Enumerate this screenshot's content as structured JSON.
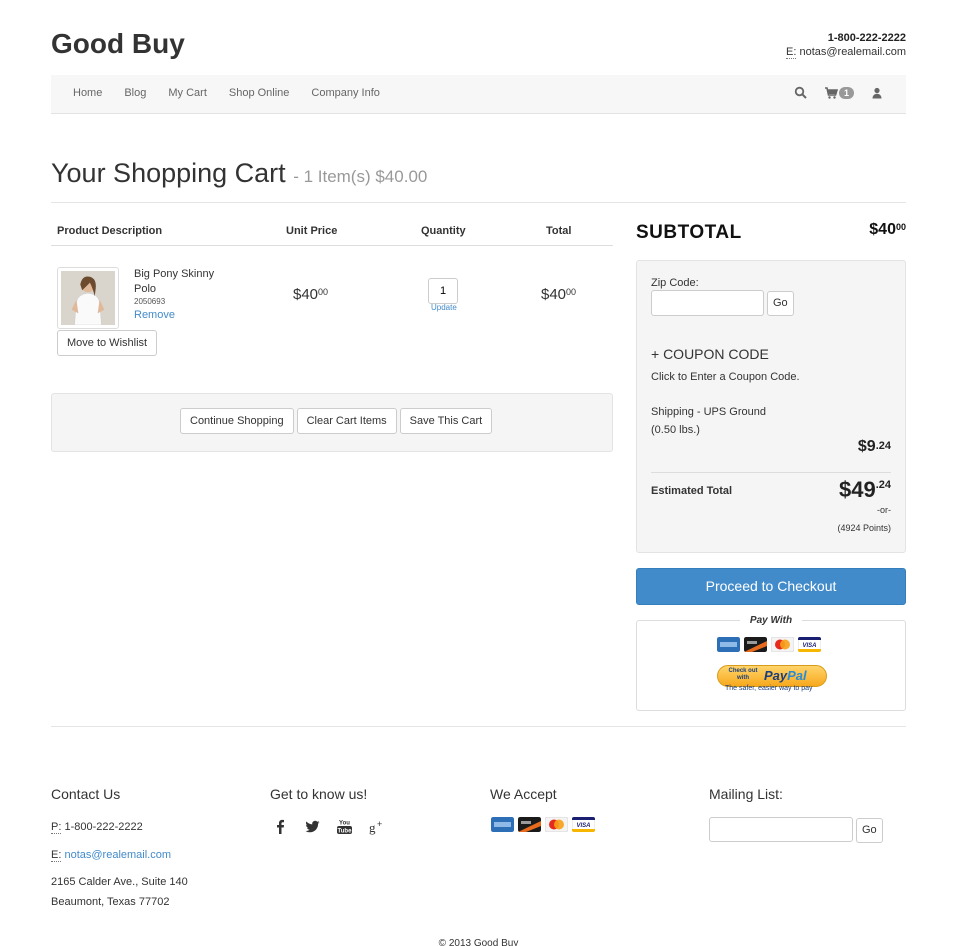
{
  "header": {
    "brand": "Good Buy",
    "phone": "1-800-222-2222",
    "email_label": "E:",
    "email": "notas@realemail.com"
  },
  "nav": {
    "links": [
      "Home",
      "Blog",
      "My Cart",
      "Shop Online",
      "Company Info"
    ],
    "cart_count": "1"
  },
  "page": {
    "title": "Your Shopping Cart",
    "subtitle": "- 1 Item(s) $40.00"
  },
  "table": {
    "headers": [
      "Product Description",
      "Unit Price",
      "Quantity",
      "Total"
    ]
  },
  "item": {
    "name": "Big Pony Skinny Polo",
    "sku": "2050693",
    "remove_label": "Remove",
    "wishlist_label": "Move to Wishlist",
    "unit_price_main": "$40",
    "unit_price_cents": "00",
    "quantity": "1",
    "update_label": "Update",
    "total_main": "$40",
    "total_cents": "00"
  },
  "actions": {
    "continue_label": "Continue Shopping",
    "clear_label": "Clear Cart Items",
    "save_label": "Save This Cart"
  },
  "summary": {
    "subtotal_label": "SUBTOTAL",
    "subtotal_main": "$40",
    "subtotal_cents": "00",
    "zip_label": "Zip Code:",
    "go_label": "Go",
    "coupon_label": "+ COUPON CODE",
    "coupon_help": "Click to Enter a Coupon Code.",
    "shipping_label": "Shipping - UPS Ground",
    "shipping_weight": "(0.50 lbs.)",
    "shipping_main": "$9",
    "shipping_cents": ".24",
    "estimated_label": "Estimated Total",
    "estimated_main": "$49",
    "estimated_cents": ".24",
    "or_text": "-or-",
    "points_text": "(4924 Points)",
    "checkout_label": "Proceed to Checkout",
    "pay_with_label": "Pay With",
    "paypal_small": "Check out with",
    "paypal_logo_a": "Pay",
    "paypal_logo_b": "Pal",
    "paypal_tagline": "The safer, easier way to pay"
  },
  "footer": {
    "contact_heading": "Contact Us",
    "phone_label": "P:",
    "phone": "1-800-222-2222",
    "email_label": "E:",
    "email": "notas@realemail.com",
    "address1": "2165 Calder Ave., Suite 140",
    "address2": "Beaumont, Texas 77702",
    "social_heading": "Get to know us!",
    "social_icons": [
      "facebook-icon",
      "twitter-icon",
      "youtube-icon",
      "google-plus-icon"
    ],
    "accept_heading": "We Accept",
    "mailing_heading": "Mailing List:",
    "mailing_go": "Go",
    "copyright": "© 2013 Good Buy"
  },
  "colors": {
    "accent": "#428bca",
    "well_bg": "#f5f5f5",
    "amex": "#2c6fb7",
    "discover": "#1a1a1a",
    "mastercard": "#f4f4f4",
    "visa": "#1a1f71"
  }
}
